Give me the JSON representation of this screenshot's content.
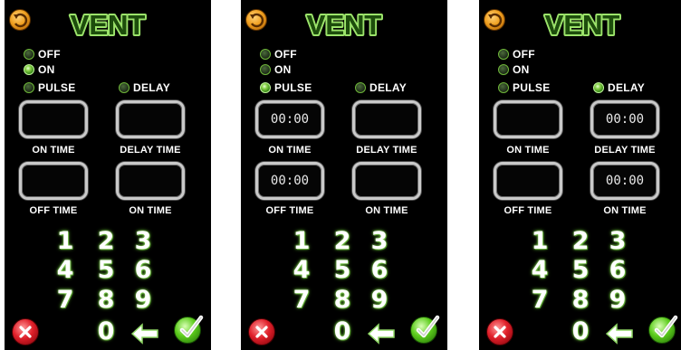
{
  "panels": [
    {
      "title": "VENT",
      "options": {
        "off": "OFF",
        "on": "ON",
        "pulse": "PULSE",
        "delay": "DELAY"
      },
      "selected": "on",
      "fields": {
        "on_time": {
          "label": "ON TIME",
          "value": ""
        },
        "delay_time": {
          "label": "DELAY TIME",
          "value": ""
        },
        "off_time": {
          "label": "OFF TIME",
          "value": ""
        },
        "on_time_2": {
          "label": "ON TIME",
          "value": ""
        }
      }
    },
    {
      "title": "VENT",
      "options": {
        "off": "OFF",
        "on": "ON",
        "pulse": "PULSE",
        "delay": "DELAY"
      },
      "selected": "pulse",
      "fields": {
        "on_time": {
          "label": "ON TIME",
          "value": "00:00"
        },
        "delay_time": {
          "label": "DELAY TIME",
          "value": ""
        },
        "off_time": {
          "label": "OFF TIME",
          "value": "00:00"
        },
        "on_time_2": {
          "label": "ON TIME",
          "value": ""
        }
      }
    },
    {
      "title": "VENT",
      "options": {
        "off": "OFF",
        "on": "ON",
        "pulse": "PULSE",
        "delay": "DELAY"
      },
      "selected": "delay",
      "fields": {
        "on_time": {
          "label": "ON TIME",
          "value": ""
        },
        "delay_time": {
          "label": "DELAY TIME",
          "value": "00:00"
        },
        "off_time": {
          "label": "OFF TIME",
          "value": ""
        },
        "on_time_2": {
          "label": "ON TIME",
          "value": "00:00"
        }
      }
    }
  ],
  "keypad": {
    "keys": [
      "1",
      "2",
      "3",
      "4",
      "5",
      "6",
      "7",
      "8",
      "9",
      "0"
    ]
  },
  "icons": {
    "back": "back-arrow-icon",
    "cancel": "cancel-x-icon",
    "confirm": "checkmark-icon",
    "backspace": "backspace-arrow-icon"
  },
  "colors": {
    "background": "#000000",
    "title_green": "#9be36a",
    "radio_green": "#6fb83a",
    "field_border": "#c9c9c9",
    "cancel_red": "#e0202a",
    "confirm_green": "#5ccc1c",
    "back_orange": "#f0a020"
  }
}
